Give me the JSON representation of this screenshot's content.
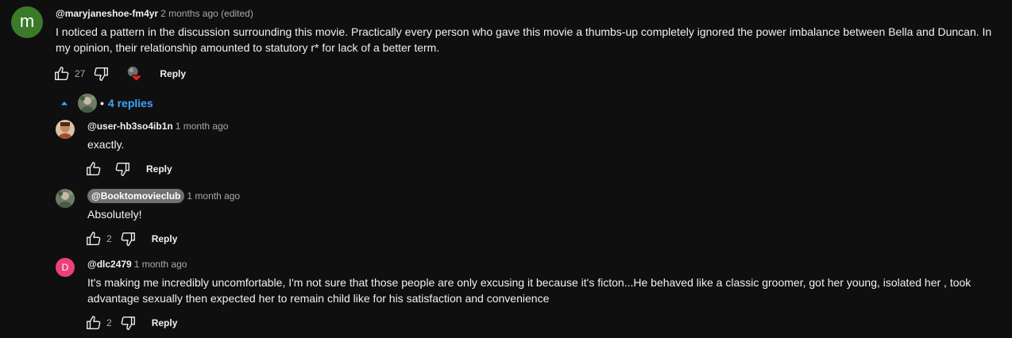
{
  "comment": {
    "avatar_letter": "m",
    "author": "@maryjaneshoe-fm4yr",
    "time": "2 months ago (edited)",
    "text": "I noticed a pattern in the discussion surrounding this movie. Practically every person who gave this movie a thumbs-up completely ignored the power imbalance between Bella and Duncan. In my opinion, their relationship amounted to statutory r* for lack of a better term.",
    "likes": "27",
    "reply_label": "Reply"
  },
  "replies_toggle": {
    "label": "4 replies",
    "separator": "•"
  },
  "replies": [
    {
      "author": "@user-hb3so4ib1n",
      "time": "1 month ago",
      "text": "exactly.",
      "likes": "",
      "reply_label": "Reply"
    },
    {
      "author": "@Booktomovieclub",
      "time": "1 month ago",
      "text": "Absolutely!",
      "likes": "2",
      "reply_label": "Reply"
    },
    {
      "avatar_letter": "D",
      "author": "@dlc2479",
      "time": "1 month ago",
      "text": "It's making me incredibly uncomfortable, I'm not sure that those people are only excusing it because it's ficton...He behaved like a classic groomer, got her young, isolated her , took advantage sexually then expected her to remain child like for his satisfaction and convenience",
      "likes": "2",
      "reply_label": "Reply"
    }
  ],
  "colors": {
    "background": "#0f0f0f",
    "link_blue": "#3ea6ff",
    "heart_red": "#e62117",
    "avatar_green": "#3a7a28",
    "avatar_pink": "#ec407a"
  },
  "icons": [
    "thumbs-up-icon",
    "thumbs-down-icon",
    "creator-heart-icon",
    "caret-up-icon"
  ]
}
